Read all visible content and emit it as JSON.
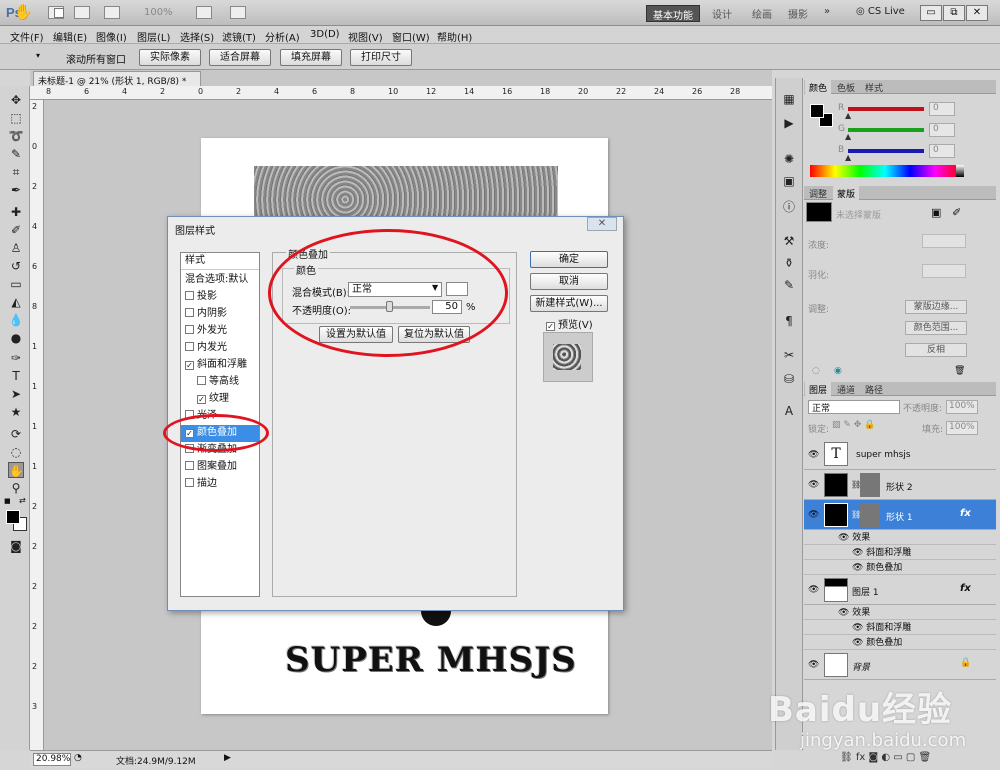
{
  "app": {
    "logo": "Ps",
    "zoom_display": "100%",
    "workspaces": [
      "基本功能",
      "设计",
      "绘画",
      "摄影",
      "»"
    ],
    "cs_live": "CS Live",
    "window_controls": [
      "▭",
      "⧉",
      "✕"
    ]
  },
  "menu": [
    "文件(F)",
    "编辑(E)",
    "图像(I)",
    "图层(L)",
    "选择(S)",
    "滤镜(T)",
    "分析(A)",
    "3D(D)",
    "视图(V)",
    "窗口(W)",
    "帮助(H)"
  ],
  "options_bar": {
    "scroll_all_label": "滚动所有窗口",
    "buttons": [
      "实际像素",
      "适合屏幕",
      "填充屏幕",
      "打印尺寸"
    ]
  },
  "document": {
    "tab_title": "未标题-1 @ 21% (形状 1, RGB/8) *",
    "tab_close": "×",
    "ruler_top": [
      "8",
      "6",
      "4",
      "2",
      "0",
      "2",
      "4",
      "6",
      "8",
      "10",
      "12",
      "14",
      "16",
      "18",
      "20",
      "22",
      "24",
      "26",
      "28"
    ],
    "ruler_left": [
      "2",
      "0",
      "2",
      "4",
      "6",
      "8",
      "1",
      "1",
      "1",
      "1",
      "2",
      "2",
      "2",
      "2",
      "2",
      "3"
    ],
    "canvas_text": "SUPER MHSJS"
  },
  "status": {
    "zoom": "20.98%",
    "doc_size": "文档:24.9M/9.12M"
  },
  "dialog": {
    "title": "图层样式",
    "close": "✕",
    "styles_header": "样式",
    "blend_default": "混合选项:默认",
    "styles": [
      {
        "label": "投影",
        "checked": false
      },
      {
        "label": "内阴影",
        "checked": false
      },
      {
        "label": "外发光",
        "checked": false
      },
      {
        "label": "内发光",
        "checked": false
      },
      {
        "label": "斜面和浮雕",
        "checked": true
      },
      {
        "label": "等高线",
        "checked": false
      },
      {
        "label": "纹理",
        "checked": true
      },
      {
        "label": "光泽",
        "checked": false
      },
      {
        "label": "颜色叠加",
        "checked": true
      },
      {
        "label": "渐变叠加",
        "checked": false
      },
      {
        "label": "图案叠加",
        "checked": false
      },
      {
        "label": "描边",
        "checked": false
      }
    ],
    "group_title": "颜色叠加",
    "color_group_title": "颜色",
    "blend_mode_label": "混合模式(B):",
    "blend_mode_value": "正常",
    "opacity_label": "不透明度(O):",
    "opacity_value": "50",
    "opacity_unit": "%",
    "set_default": "设置为默认值",
    "reset_default": "复位为默认值",
    "ok": "确定",
    "cancel": "取消",
    "new_style": "新建样式(W)...",
    "preview_label": "预览(V)",
    "preview_checked": true
  },
  "color_panel": {
    "tabs": [
      "颜色",
      "色板",
      "样式"
    ],
    "channels": [
      {
        "label": "R",
        "value": "0",
        "color": "#c0101a"
      },
      {
        "label": "G",
        "value": "0",
        "color": "#1aa01a"
      },
      {
        "label": "B",
        "value": "0",
        "color": "#1a1ab0"
      }
    ]
  },
  "masks_panel": {
    "tabs": [
      "调整",
      "蒙版"
    ],
    "no_mask": "未选择蒙版",
    "density_label": "浓度:",
    "feather_label": "羽化:",
    "refine_label": "调整:",
    "buttons": [
      "蒙版边缘...",
      "颜色范围...",
      "反相"
    ]
  },
  "layers_panel": {
    "tabs": [
      "图层",
      "通道",
      "路径"
    ],
    "blend_mode": "正常",
    "opacity_label": "不透明度:",
    "opacity_value": "100%",
    "lock_label": "锁定:",
    "fill_label": "填充:",
    "fill_value": "100%",
    "layers": [
      {
        "name": "super mhsjs",
        "type": "text",
        "thumb": "T"
      },
      {
        "name": "形状 2",
        "type": "shape"
      },
      {
        "name": "形状 1",
        "type": "shape",
        "selected": true,
        "fx": "fx"
      },
      {
        "name": "图层 1",
        "type": "raster",
        "fx": "fx"
      },
      {
        "name": "背景",
        "type": "background",
        "lock": "🔒"
      }
    ],
    "effects_label": "效果",
    "effect_items": [
      "斜面和浮雕",
      "颜色叠加"
    ]
  },
  "watermark": {
    "brand": "Baidu经验",
    "url": "jingyan.baidu.com"
  },
  "accent": {
    "selection": "#3d80d8",
    "annotation": "#e0141e"
  }
}
